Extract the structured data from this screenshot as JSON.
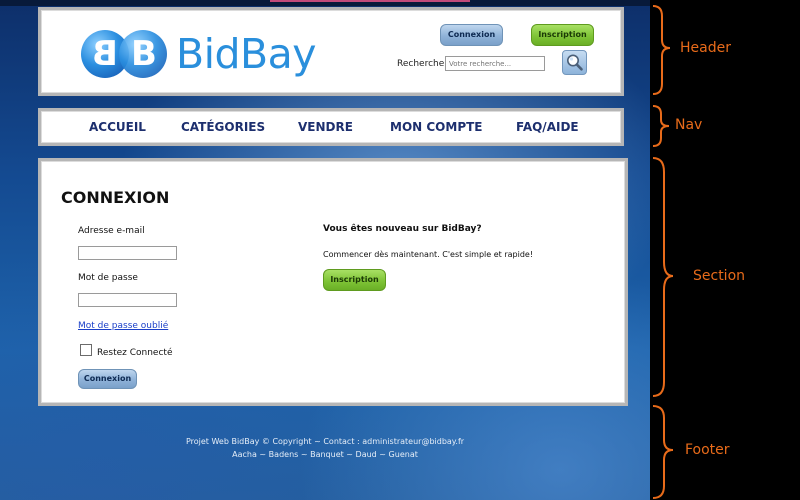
{
  "header": {
    "logo_text": "BidBay",
    "logo_letters": [
      "B",
      "B"
    ],
    "connexion_label": "Connexion",
    "inscription_label": "Inscription",
    "search_label": "Recherche :",
    "search_placeholder": "Votre recherche..."
  },
  "nav": {
    "items": [
      "ACCUEIL",
      "CATÉGORIES",
      "VENDRE",
      "MON COMPTE",
      "FAQ/AIDE"
    ]
  },
  "section": {
    "title": "CONNEXION",
    "email_label": "Adresse e-mail",
    "password_label": "Mot de passe",
    "forgot_link": "Mot de passe oublié",
    "remember_label": "Restez Connecté",
    "connexion_button": "Connexion",
    "new_title": "Vous êtes nouveau sur BidBay?",
    "new_text": "Commencer dès maintenant. C'est simple et rapide!",
    "inscription_button": "Inscription"
  },
  "footer": {
    "line1": "Projet Web BidBay © Copyright ~ Contact : administrateur@bidbay.fr",
    "line2": "Aacha ~ Badens ~ Banquet ~ Daud ~ Guenat"
  },
  "annotations": {
    "header": "Header",
    "nav": "Nav",
    "section": "Section",
    "footer": "Footer"
  },
  "colors": {
    "annotation": "#e86b1a",
    "logo_blue": "#2a8fdc",
    "nav_text": "#1d2f6e",
    "green_button": "#7fc437",
    "blue_button": "#8fb2d8"
  },
  "icons": [
    "search-icon",
    "bidbay-logo"
  ]
}
